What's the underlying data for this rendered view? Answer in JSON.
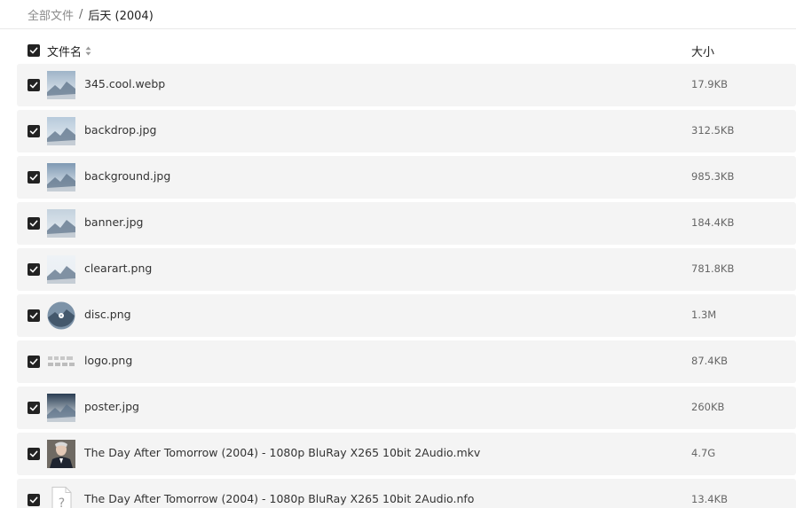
{
  "breadcrumb": {
    "root": "全部文件",
    "separator": "/",
    "current": "后天 (2004)"
  },
  "table": {
    "header": {
      "name_label": "文件名",
      "size_label": "大小",
      "sort_icon": "sort-icon"
    },
    "rows": [
      {
        "name": "345.cool.webp",
        "size": "17.9KB",
        "thumb": "image-thumbnail"
      },
      {
        "name": "backdrop.jpg",
        "size": "312.5KB",
        "thumb": "image-thumbnail"
      },
      {
        "name": "background.jpg",
        "size": "985.3KB",
        "thumb": "image-thumbnail"
      },
      {
        "name": "banner.jpg",
        "size": "184.4KB",
        "thumb": "image-thumbnail"
      },
      {
        "name": "clearart.png",
        "size": "781.8KB",
        "thumb": "image-thumbnail"
      },
      {
        "name": "disc.png",
        "size": "1.3M",
        "thumb": "disc-thumbnail"
      },
      {
        "name": "logo.png",
        "size": "87.4KB",
        "thumb": "logo-thumbnail"
      },
      {
        "name": "poster.jpg",
        "size": "260KB",
        "thumb": "image-thumbnail"
      },
      {
        "name": "The Day After Tomorrow (2004) - 1080p BluRay X265 10bit 2Audio.mkv",
        "size": "4.7G",
        "thumb": "video-thumbnail"
      },
      {
        "name": "The Day After Tomorrow (2004) - 1080p BluRay X265 10bit 2Audio.nfo",
        "size": "13.4KB",
        "thumb": "unknown-file-icon"
      }
    ]
  },
  "colors": {
    "row_background": "#f4f4f4",
    "checkbox": "#222222",
    "breadcrumb_muted": "#8a8a8a"
  }
}
